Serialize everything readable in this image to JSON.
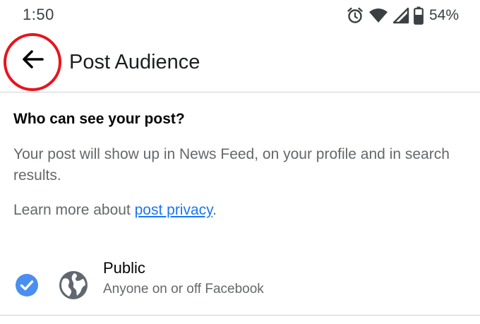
{
  "status_bar": {
    "time": "1:50",
    "battery_percent": "54%",
    "icons": [
      "alarm-icon",
      "wifi-icon",
      "signal-icon",
      "battery-icon"
    ]
  },
  "app_bar": {
    "back_icon": "arrow-left-icon",
    "title": "Post Audience"
  },
  "content": {
    "heading": "Who can see your post?",
    "description": "Your post will show up in News Feed, on your profile and in search results.",
    "learn_more_prefix": "Learn more about ",
    "learn_more_link": "post privacy",
    "learn_more_suffix": "."
  },
  "options": [
    {
      "title": "Public",
      "subtitle": "Anyone on or off Facebook",
      "icon": "globe-icon",
      "selected": true
    }
  ],
  "colors": {
    "accent": "#1877f2",
    "check": "#4a8ff0",
    "highlight_ring": "#e8141c",
    "secondary_text": "#65676b"
  }
}
